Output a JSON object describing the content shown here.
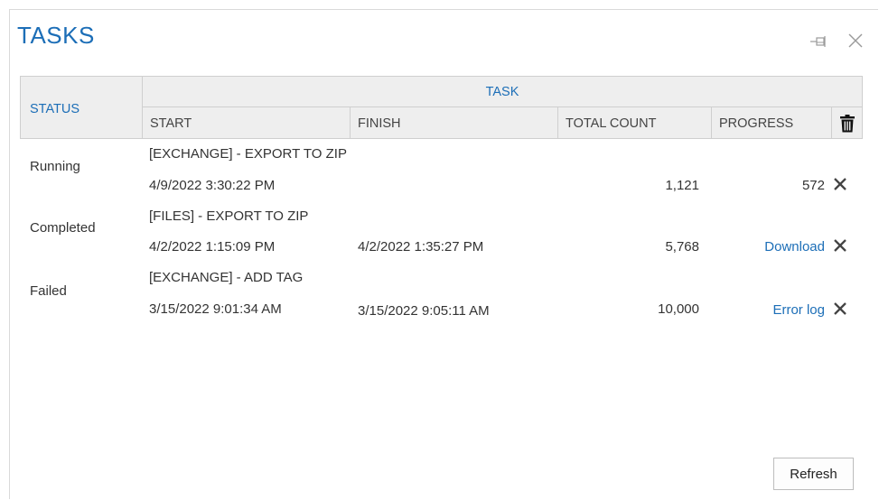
{
  "dialog": {
    "title": "TASKS"
  },
  "table": {
    "headers": {
      "status": "STATUS",
      "task": "TASK",
      "start": "START",
      "finish": "FINISH",
      "total_count": "TOTAL COUNT",
      "progress": "PROGRESS"
    },
    "rows": [
      {
        "status": "Running",
        "task": "[EXCHANGE] - EXPORT TO ZIP",
        "start": "4/9/2022 3:30:22 PM",
        "finish": "",
        "total_count": "1,121",
        "progress": "572"
      },
      {
        "status": "Completed",
        "task": "[FILES] - EXPORT TO ZIP",
        "start": "4/2/2022 1:15:09 PM",
        "finish": "4/2/2022 1:35:27 PM",
        "total_count": "5,768",
        "progress": "Download"
      },
      {
        "status": "Failed",
        "task": "[EXCHANGE] - ADD TAG",
        "start": "3/15/2022 9:01:34 AM",
        "finish": "3/15/2022 9:05:11 AM",
        "total_count": "10,000",
        "progress": "Error log"
      }
    ]
  },
  "footer": {
    "refresh_label": "Refresh"
  },
  "icons": {
    "pin": "pin-icon",
    "close": "close-icon",
    "trash": "trash-icon",
    "remove": "x-icon"
  },
  "colors": {
    "accent": "#1c6eb7",
    "header_bg": "#eeeeee",
    "text": "#333333"
  }
}
